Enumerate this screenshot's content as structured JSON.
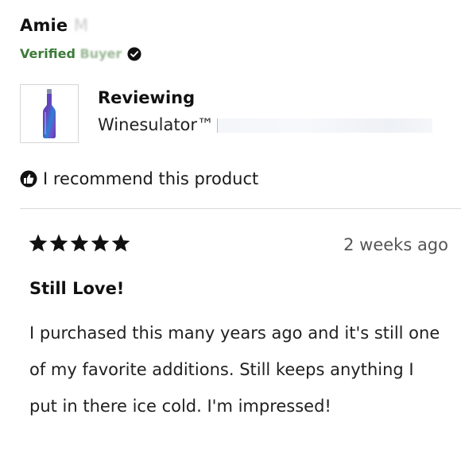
{
  "reviewer": {
    "name": "Amie",
    "name_obscured": "M",
    "badge_prefix": "Verified",
    "badge_obscured": "Buyer"
  },
  "product": {
    "reviewing_label": "Reviewing",
    "name": "Winesulator™",
    "image_icon": "wine-bottle-image"
  },
  "recommendation": {
    "text": "I recommend this product",
    "icon": "thumbs-up-icon"
  },
  "review": {
    "rating": 5,
    "rating_max": 5,
    "date": "2 weeks ago",
    "title": "Still Love!",
    "body": "I purchased this many years ago and it's still one of my favorite additions. Still keeps anything I put in there ice cold. I'm impressed!"
  },
  "colors": {
    "verified": "#3c7a37",
    "text": "#1a1a1a",
    "divider": "#d9d9d9"
  }
}
